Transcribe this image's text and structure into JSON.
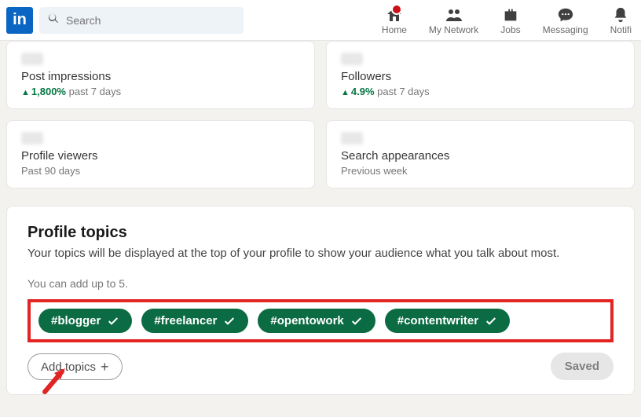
{
  "header": {
    "logo_text": "in",
    "search_placeholder": "Search",
    "nav": [
      {
        "label": "Home"
      },
      {
        "label": "My Network"
      },
      {
        "label": "Jobs"
      },
      {
        "label": "Messaging"
      },
      {
        "label": "Notifi"
      }
    ]
  },
  "stats": {
    "row1": [
      {
        "title": "Post impressions",
        "delta": "1,800%",
        "period": "past 7 days"
      },
      {
        "title": "Followers",
        "delta": "4.9%",
        "period": "past 7 days"
      }
    ],
    "row2": [
      {
        "title": "Profile viewers",
        "period": "Past 90 days"
      },
      {
        "title": "Search appearances",
        "period": "Previous week"
      }
    ]
  },
  "topics": {
    "title": "Profile topics",
    "desc": "Your topics will be displayed at the top of your profile to show your audience what you talk about most.",
    "limit": "You can add up to 5.",
    "items": [
      "#blogger",
      "#freelancer",
      "#opentowork",
      "#contentwriter"
    ],
    "add_label": "Add topics",
    "saved_label": "Saved"
  }
}
